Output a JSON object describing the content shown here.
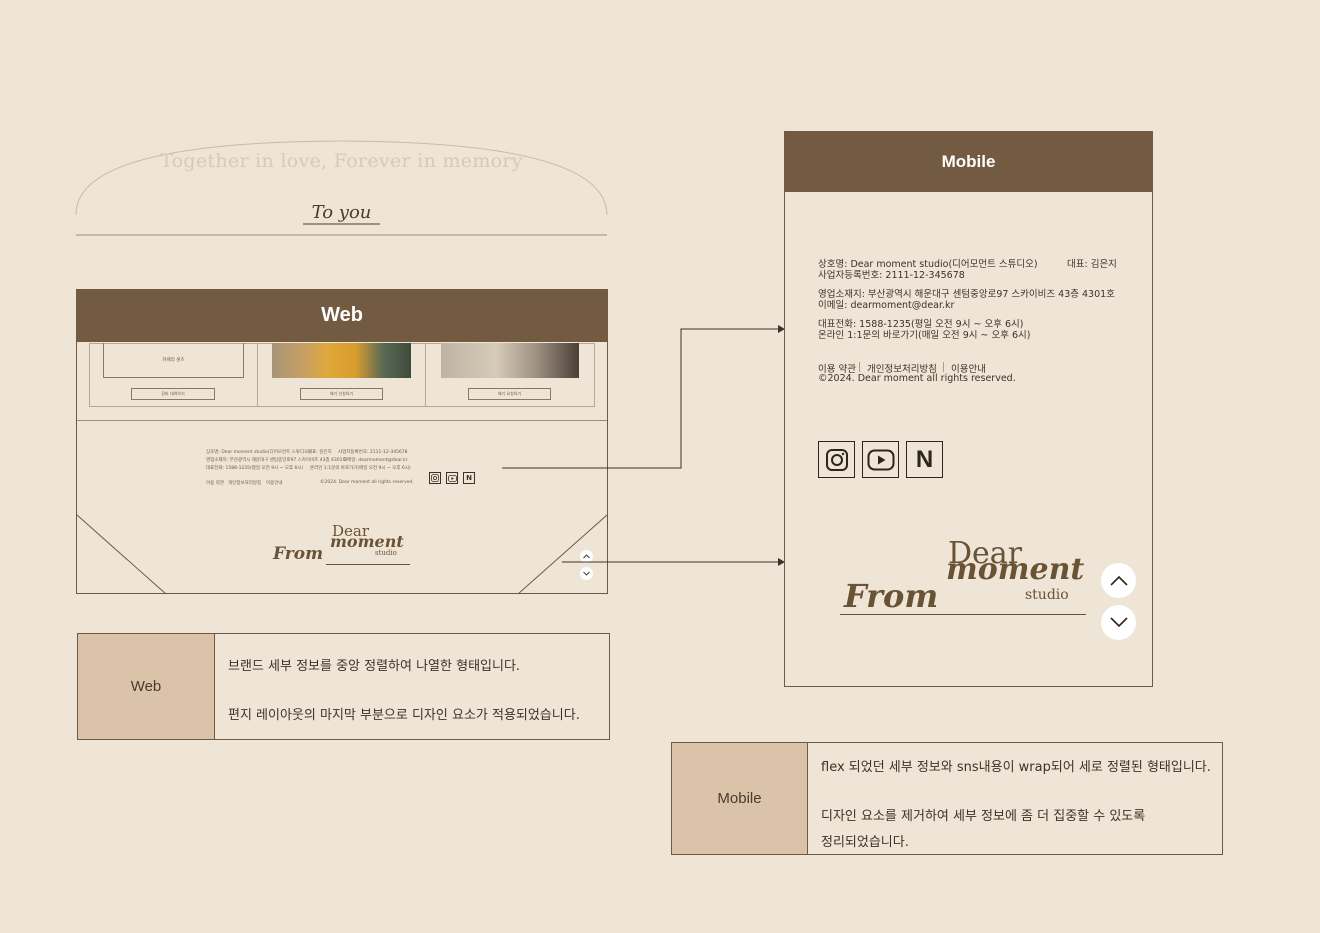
{
  "web_preview": {
    "tagline": "Together in love, Forever in memory",
    "signoff": "To you",
    "header": "Web",
    "cards": [
      {
        "title": "카페라 센츠",
        "button": "장바 대여하기"
      },
      {
        "button": "제기 신청하기"
      },
      {
        "button": "제기 요청하기"
      }
    ],
    "footer": {
      "company": "상호명: Dear moment studio(디어모먼트 스튜디오)",
      "ceo": "대표: 김은지",
      "business_no": "사업자등록번호: 2111-12-345678",
      "address": "영업소재지: 부산광역시 해운대구 센텀중앙로97 스카이비즈 43층 4301호",
      "email": "이메일: dearmoment@dear.kr",
      "phone": "대표전화: 1588-1235(평일 오전 9시 ~ 오후 6시)",
      "online": "온라인 1:1문의 바로가기(매일 오전 9시 ~ 오후 6시)",
      "links": [
        "이용 약관",
        "개인정보처리방침",
        "이용안내"
      ],
      "copyright": "©2024. Dear moment all rights reserved."
    },
    "signature": {
      "from": "From",
      "dear": "Dear",
      "moment": "moment",
      "studio": "studio"
    }
  },
  "web_desc": {
    "label": "Web",
    "line1": "브랜드 세부 정보를 중앙 정렬하여 나열한 형태입니다.",
    "line2": "편지 레이아웃의 마지막 부분으로 디자인 요소가 적용되었습니다."
  },
  "mobile_preview": {
    "header": "Mobile",
    "company": "상호명: Dear moment studio(디어모먼트 스튜디오)",
    "ceo": "대표: 김은지",
    "business_no": "사업자등록번호: 2111-12-345678",
    "address": "영업소재지: 부산광역시 해운대구 센텀중앙로97 스카이비즈 43층 4301호",
    "email": "이메일: dearmoment@dear.kr",
    "phone": "대표전화: 1588-1235(평일 오전 9시 ~ 오후 6시)",
    "online": "온라인 1:1문의 바로가기(매일 오전 9시 ~ 오후 6시)",
    "links": [
      "이용 약관",
      "개인정보처리방침",
      "이용안내"
    ],
    "copyright": "©2024. Dear moment all rights reserved.",
    "sns_icons": [
      "instagram-icon",
      "youtube-icon",
      "naver-icon"
    ],
    "naver_letter": "N",
    "signature": {
      "from": "From",
      "dear": "Dear",
      "moment": "moment",
      "studio": "studio"
    }
  },
  "mobile_desc": {
    "label": "Mobile",
    "line1": "flex 되었던 세부 정보와 sns내용이 wrap되어 세로 정렬된 형태입니다.",
    "line2": "디자인 요소를 제거하여 세부 정보에 좀 더 집중할 수 있도록",
    "line3": "정리되었습니다."
  },
  "colors": {
    "background": "#eee5d7",
    "header_brown": "#735b42",
    "label_beige": "#dbc3aa",
    "text_dark": "#3c3226"
  }
}
